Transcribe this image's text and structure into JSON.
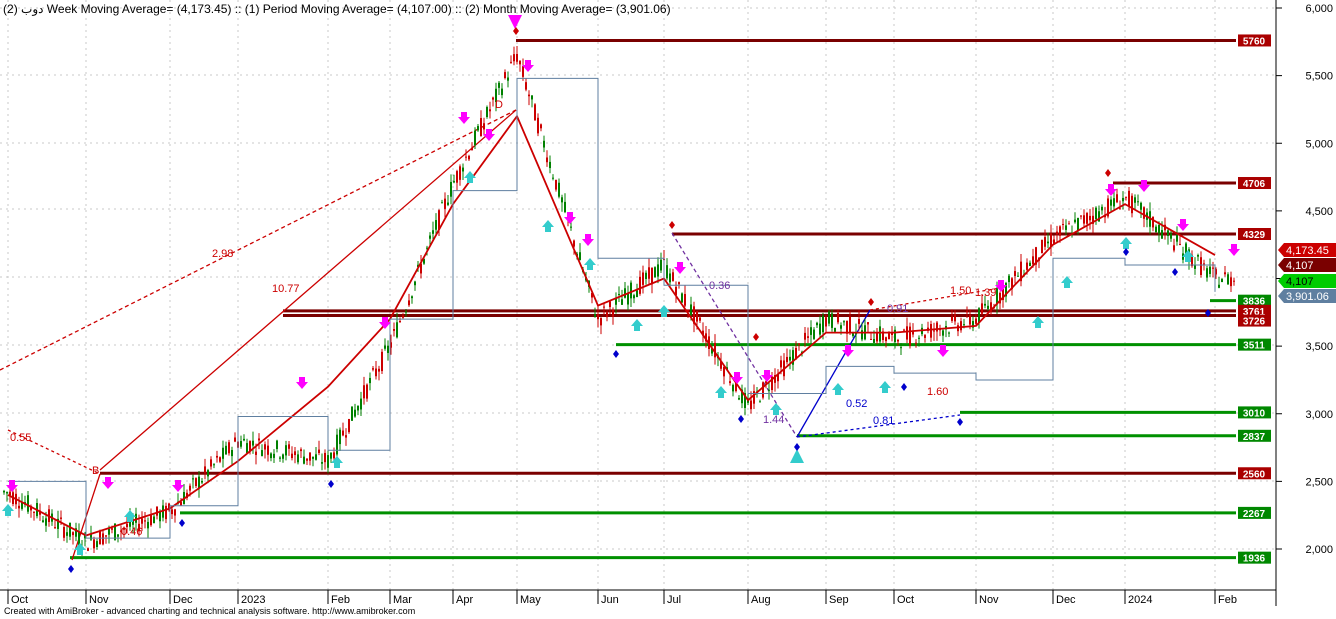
{
  "header": {
    "text": "دوب (2) Week Moving Average= (4,173.45) :: (1) Period Moving Average= (4,107.00) :: (2) Month Moving Average= (3,901.06)"
  },
  "footer": {
    "text": "Created with AmiBroker - advanced charting and technical analysis software. http://www.amibroker.com"
  },
  "colors": {
    "resistance": "#7a0000",
    "support": "#009000",
    "price_up": "#008000",
    "price_down": "#cc0000",
    "ma_week": "#cc0000",
    "ma_month": "#5f7fa0",
    "ma_period": "#00b000",
    "sell_arrow": "#ff00ff",
    "buy_arrow": "#33cccc",
    "pivot_low": "#0000cc",
    "pivot_high": "#cc0000"
  },
  "chart_data": {
    "type": "line",
    "title": "",
    "xlabel": "",
    "ylabel": "",
    "x_tick_labels": [
      "Oct",
      "Nov",
      "Dec",
      "2023",
      "Feb",
      "Mar",
      "Apr",
      "May",
      "Jun",
      "Jul",
      "Aug",
      "Sep",
      "Oct",
      "Nov",
      "Dec",
      "2024",
      "Feb"
    ],
    "y_tick_labels": [
      "2,000",
      "2,500",
      "3,000",
      "3,500",
      "4,000",
      "4,500",
      "5,000",
      "5,500",
      "6,000"
    ],
    "ylim": [
      1800,
      6050
    ],
    "grid": true,
    "series": [
      {
        "key": "price",
        "x": [
          "Oct",
          "Nov",
          "Dec",
          "2023",
          "Feb",
          "Mar",
          "Apr",
          "May",
          "Jun",
          "Jul",
          "Aug",
          "Sep",
          "Oct",
          "Nov",
          "Dec",
          "2024",
          "Feb"
        ],
        "values": [
          2420,
          2050,
          2280,
          2800,
          2650,
          3500,
          4700,
          5650,
          3700,
          4100,
          3050,
          3700,
          3550,
          3700,
          4300,
          4600,
          4000
        ]
      },
      {
        "key": "week_ma",
        "x": [
          "Oct",
          "Nov",
          "Dec",
          "2023",
          "Feb",
          "Mar",
          "Apr",
          "May",
          "Jun",
          "Jul",
          "Aug",
          "Sep",
          "Oct",
          "Nov",
          "Dec",
          "2024",
          "Feb"
        ],
        "values": [
          2400,
          2100,
          2300,
          2650,
          3200,
          3700,
          4550,
          5200,
          3800,
          4000,
          3100,
          3600,
          3600,
          3650,
          4250,
          4550,
          4173.45
        ]
      },
      {
        "key": "month_ma",
        "x": [
          "Oct",
          "Nov",
          "Dec",
          "2023",
          "Feb",
          "Mar",
          "Apr",
          "May",
          "Jun",
          "Jul",
          "Aug",
          "Sep",
          "Oct",
          "Nov",
          "Dec",
          "2024",
          "Feb"
        ],
        "values": [
          2500,
          2080,
          2320,
          2980,
          2730,
          3700,
          4650,
          5480,
          4150,
          3950,
          3150,
          3350,
          3300,
          3250,
          4150,
          4100,
          3901.06
        ]
      }
    ],
    "horizontal_levels": [
      {
        "value": 5760,
        "label": "5760",
        "kind": "resistance"
      },
      {
        "value": 4706,
        "label": "4706",
        "kind": "resistance"
      },
      {
        "value": 4329,
        "label": "4329",
        "kind": "resistance"
      },
      {
        "value": 3836,
        "label": "3836",
        "kind": "support"
      },
      {
        "value": 3761,
        "label": "3761",
        "kind": "resistance"
      },
      {
        "value": 3726,
        "label": "3726",
        "kind": "resistance"
      },
      {
        "value": 3511,
        "label": "3511",
        "kind": "support"
      },
      {
        "value": 3010,
        "label": "3010",
        "kind": "support"
      },
      {
        "value": 2837,
        "label": "2837",
        "kind": "support"
      },
      {
        "value": 2560,
        "label": "2560",
        "kind": "resistance"
      },
      {
        "value": 2267,
        "label": "2267",
        "kind": "support"
      },
      {
        "value": 1936,
        "label": "1936",
        "kind": "support"
      }
    ],
    "value_badges": [
      {
        "value": 4173.45,
        "label": "4,173.45",
        "color": "#cc0000"
      },
      {
        "value": 4107,
        "label": "4,107",
        "color": "#7a0000"
      },
      {
        "value": 4107,
        "label": "4,107",
        "color": "#00cc00"
      },
      {
        "value": 3901.06,
        "label": "3,901.06",
        "color": "#5f7fa0"
      }
    ],
    "annotations": [
      {
        "text": "0.55",
        "color": "#cc0000"
      },
      {
        "text": "B",
        "color": "#cc0000"
      },
      {
        "text": "0.46",
        "color": "#cc0000"
      },
      {
        "text": "2.98",
        "color": "#cc0000"
      },
      {
        "text": "10.77",
        "color": "#cc0000"
      },
      {
        "text": "D",
        "color": "#cc0000"
      },
      {
        "text": "0.36",
        "color": "#7030a0"
      },
      {
        "text": "1.44",
        "color": "#7030a0"
      },
      {
        "text": "0.52",
        "color": "#0000cc"
      },
      {
        "text": "0.81",
        "color": "#0000cc"
      },
      {
        "text": "0.91",
        "color": "#7030a0"
      },
      {
        "text": "1.60",
        "color": "#cc0000"
      },
      {
        "text": "1.50",
        "color": "#cc0000"
      },
      {
        "text": "1.39",
        "color": "#cc0000"
      }
    ]
  }
}
